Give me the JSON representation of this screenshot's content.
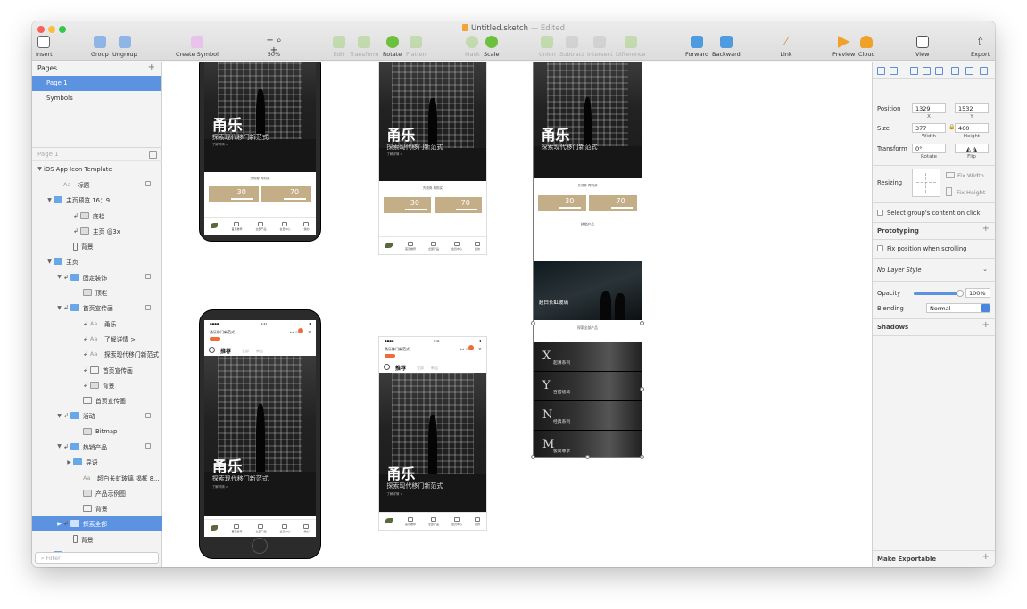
{
  "window": {
    "title": "Untitled.sketch",
    "edited": "— Edited"
  },
  "toolbar": {
    "insert": "Insert",
    "group": "Group",
    "ungroup": "Ungroup",
    "create_symbol": "Create Symbol",
    "zoom": "50%",
    "zoom_minus": "−",
    "zoom_plus": "+",
    "edit": "Edit",
    "transform": "Transform",
    "rotate": "Rotate",
    "flatten": "Flatten",
    "mask": "Mask",
    "scale": "Scale",
    "union": "Union",
    "subtract": "Subtract",
    "intersect": "Intersect",
    "difference": "Difference",
    "forward": "Forward",
    "backward": "Backward",
    "link": "Link",
    "preview": "Preview",
    "cloud": "Cloud",
    "view": "View",
    "export": "Export"
  },
  "pages": {
    "header": "Pages",
    "items": [
      "Page 1",
      "Symbols"
    ]
  },
  "layers": {
    "page_label": "Page 1",
    "filter_placeholder": "Filter",
    "items": [
      {
        "label": "iOS App Icon Template",
        "indent": 0,
        "arrow": "▼",
        "icon": "",
        "lock": false
      },
      {
        "label": "标题",
        "indent": 2,
        "arrow": "",
        "icon": "text",
        "lock": true
      },
      {
        "label": "主页预览 16：9",
        "indent": 1,
        "arrow": "▼",
        "icon": "folder",
        "lock": false
      },
      {
        "label": "底栏",
        "indent": 3,
        "arrow": "",
        "icon": "img",
        "lock": false,
        "mask": true
      },
      {
        "label": "主页 @3x",
        "indent": 3,
        "arrow": "",
        "icon": "img",
        "lock": false,
        "mask": true
      },
      {
        "label": "背景",
        "indent": 3,
        "arrow": "",
        "icon": "phone",
        "lock": false
      },
      {
        "label": "主页",
        "indent": 1,
        "arrow": "▼",
        "icon": "folder",
        "lock": false
      },
      {
        "label": "固定装饰",
        "indent": 2,
        "arrow": "▼",
        "icon": "folder",
        "lock": true,
        "mask": true
      },
      {
        "label": "顶栏",
        "indent": 4,
        "arrow": "",
        "icon": "img",
        "lock": false
      },
      {
        "label": "首页宣传画",
        "indent": 2,
        "arrow": "▼",
        "icon": "folder",
        "lock": true,
        "mask": true
      },
      {
        "label": "甬乐",
        "indent": 4,
        "arrow": "",
        "icon": "text",
        "lock": false,
        "mask": true
      },
      {
        "label": "了解详情 >",
        "indent": 4,
        "arrow": "",
        "icon": "text",
        "lock": false,
        "mask": true
      },
      {
        "label": "探索现代移门新范式",
        "indent": 4,
        "arrow": "",
        "icon": "text",
        "lock": false,
        "mask": true
      },
      {
        "label": "首页宣传画",
        "indent": 4,
        "arrow": "",
        "icon": "rect",
        "lock": false,
        "mask": true
      },
      {
        "label": "背景",
        "indent": 4,
        "arrow": "",
        "icon": "img",
        "lock": false,
        "mask": true
      },
      {
        "label": "首页宣传画",
        "indent": 4,
        "arrow": "",
        "icon": "rect",
        "lock": false
      },
      {
        "label": "活动",
        "indent": 2,
        "arrow": "▼",
        "icon": "folder",
        "lock": true,
        "mask": true
      },
      {
        "label": "Bitmap",
        "indent": 4,
        "arrow": "",
        "icon": "img",
        "lock": false
      },
      {
        "label": "热销产品",
        "indent": 2,
        "arrow": "▼",
        "icon": "folder",
        "lock": true,
        "mask": true
      },
      {
        "label": "导语",
        "indent": 3,
        "arrow": "▶",
        "icon": "folder",
        "lock": false
      },
      {
        "label": "超白长虹玻璃 揭框 8...",
        "indent": 4,
        "arrow": "",
        "icon": "text",
        "lock": false
      },
      {
        "label": "产品示例图",
        "indent": 4,
        "arrow": "",
        "icon": "img",
        "lock": false
      },
      {
        "label": "背景",
        "indent": 4,
        "arrow": "",
        "icon": "rect",
        "lock": false
      },
      {
        "label": "探索全部",
        "indent": 2,
        "arrow": "▶",
        "icon": "folder",
        "lock": false,
        "mask": true,
        "selected": true
      },
      {
        "label": "背景",
        "indent": 3,
        "arrow": "",
        "icon": "phone",
        "lock": false
      },
      {
        "label": "主页预览 21：9",
        "indent": 1,
        "arrow": "▼",
        "icon": "folder",
        "lock": false
      },
      {
        "label": "底栏",
        "indent": 3,
        "arrow": "",
        "icon": "img",
        "lock": true,
        "mask": true
      }
    ]
  },
  "inspector": {
    "position_label": "Position",
    "position_x": "1329",
    "position_y": "1532",
    "x_label": "X",
    "y_label": "Y",
    "size_label": "Size",
    "width": "377",
    "height": "460",
    "width_label": "Width",
    "height_label": "Height",
    "transform_label": "Transform",
    "rotate_value": "0°",
    "rotate_label": "Rotate",
    "flip_label": "Flip",
    "resizing_label": "Resizing",
    "fix_width": "Fix Width",
    "fix_height": "Fix Height",
    "select_group_content": "Select group's content on click",
    "prototyping": "Prototyping",
    "fix_position": "Fix position when scrolling",
    "layer_style": "No Layer Style",
    "opacity_label": "Opacity",
    "opacity_value": "100%",
    "opacity": 1.0,
    "blending_label": "Blending",
    "blending_value": "Normal",
    "shadows": "Shadows",
    "make_exportable": "Make Exportable"
  },
  "artboard": {
    "hero_title": "甬乐",
    "hero_sub": "探索现代移门新范式",
    "hero_more": "了解详情 >",
    "section_title": "先领券 再购买",
    "coupon1": "30",
    "coupon2": "70",
    "hot_title": "热销产品",
    "product_caption": "超白长虹玻璃",
    "explore_title": "探索全部产品",
    "tabs": [
      "首页推荐",
      "全部产品",
      "会员中心",
      "我的"
    ],
    "app_name": "甬乐移门新范式",
    "search_tabs": [
      "推荐",
      "全部",
      "新品"
    ],
    "explore_letters": [
      "X",
      "Y",
      "N",
      "M"
    ],
    "explore_texts": [
      "超薄系列",
      "百搭极简",
      "经典系列",
      "极简尊享"
    ]
  },
  "colors": {
    "selection_blue": "#5b93e0",
    "coupon_gold": "#c4ae87",
    "badge_orange": "#f06a3a"
  }
}
